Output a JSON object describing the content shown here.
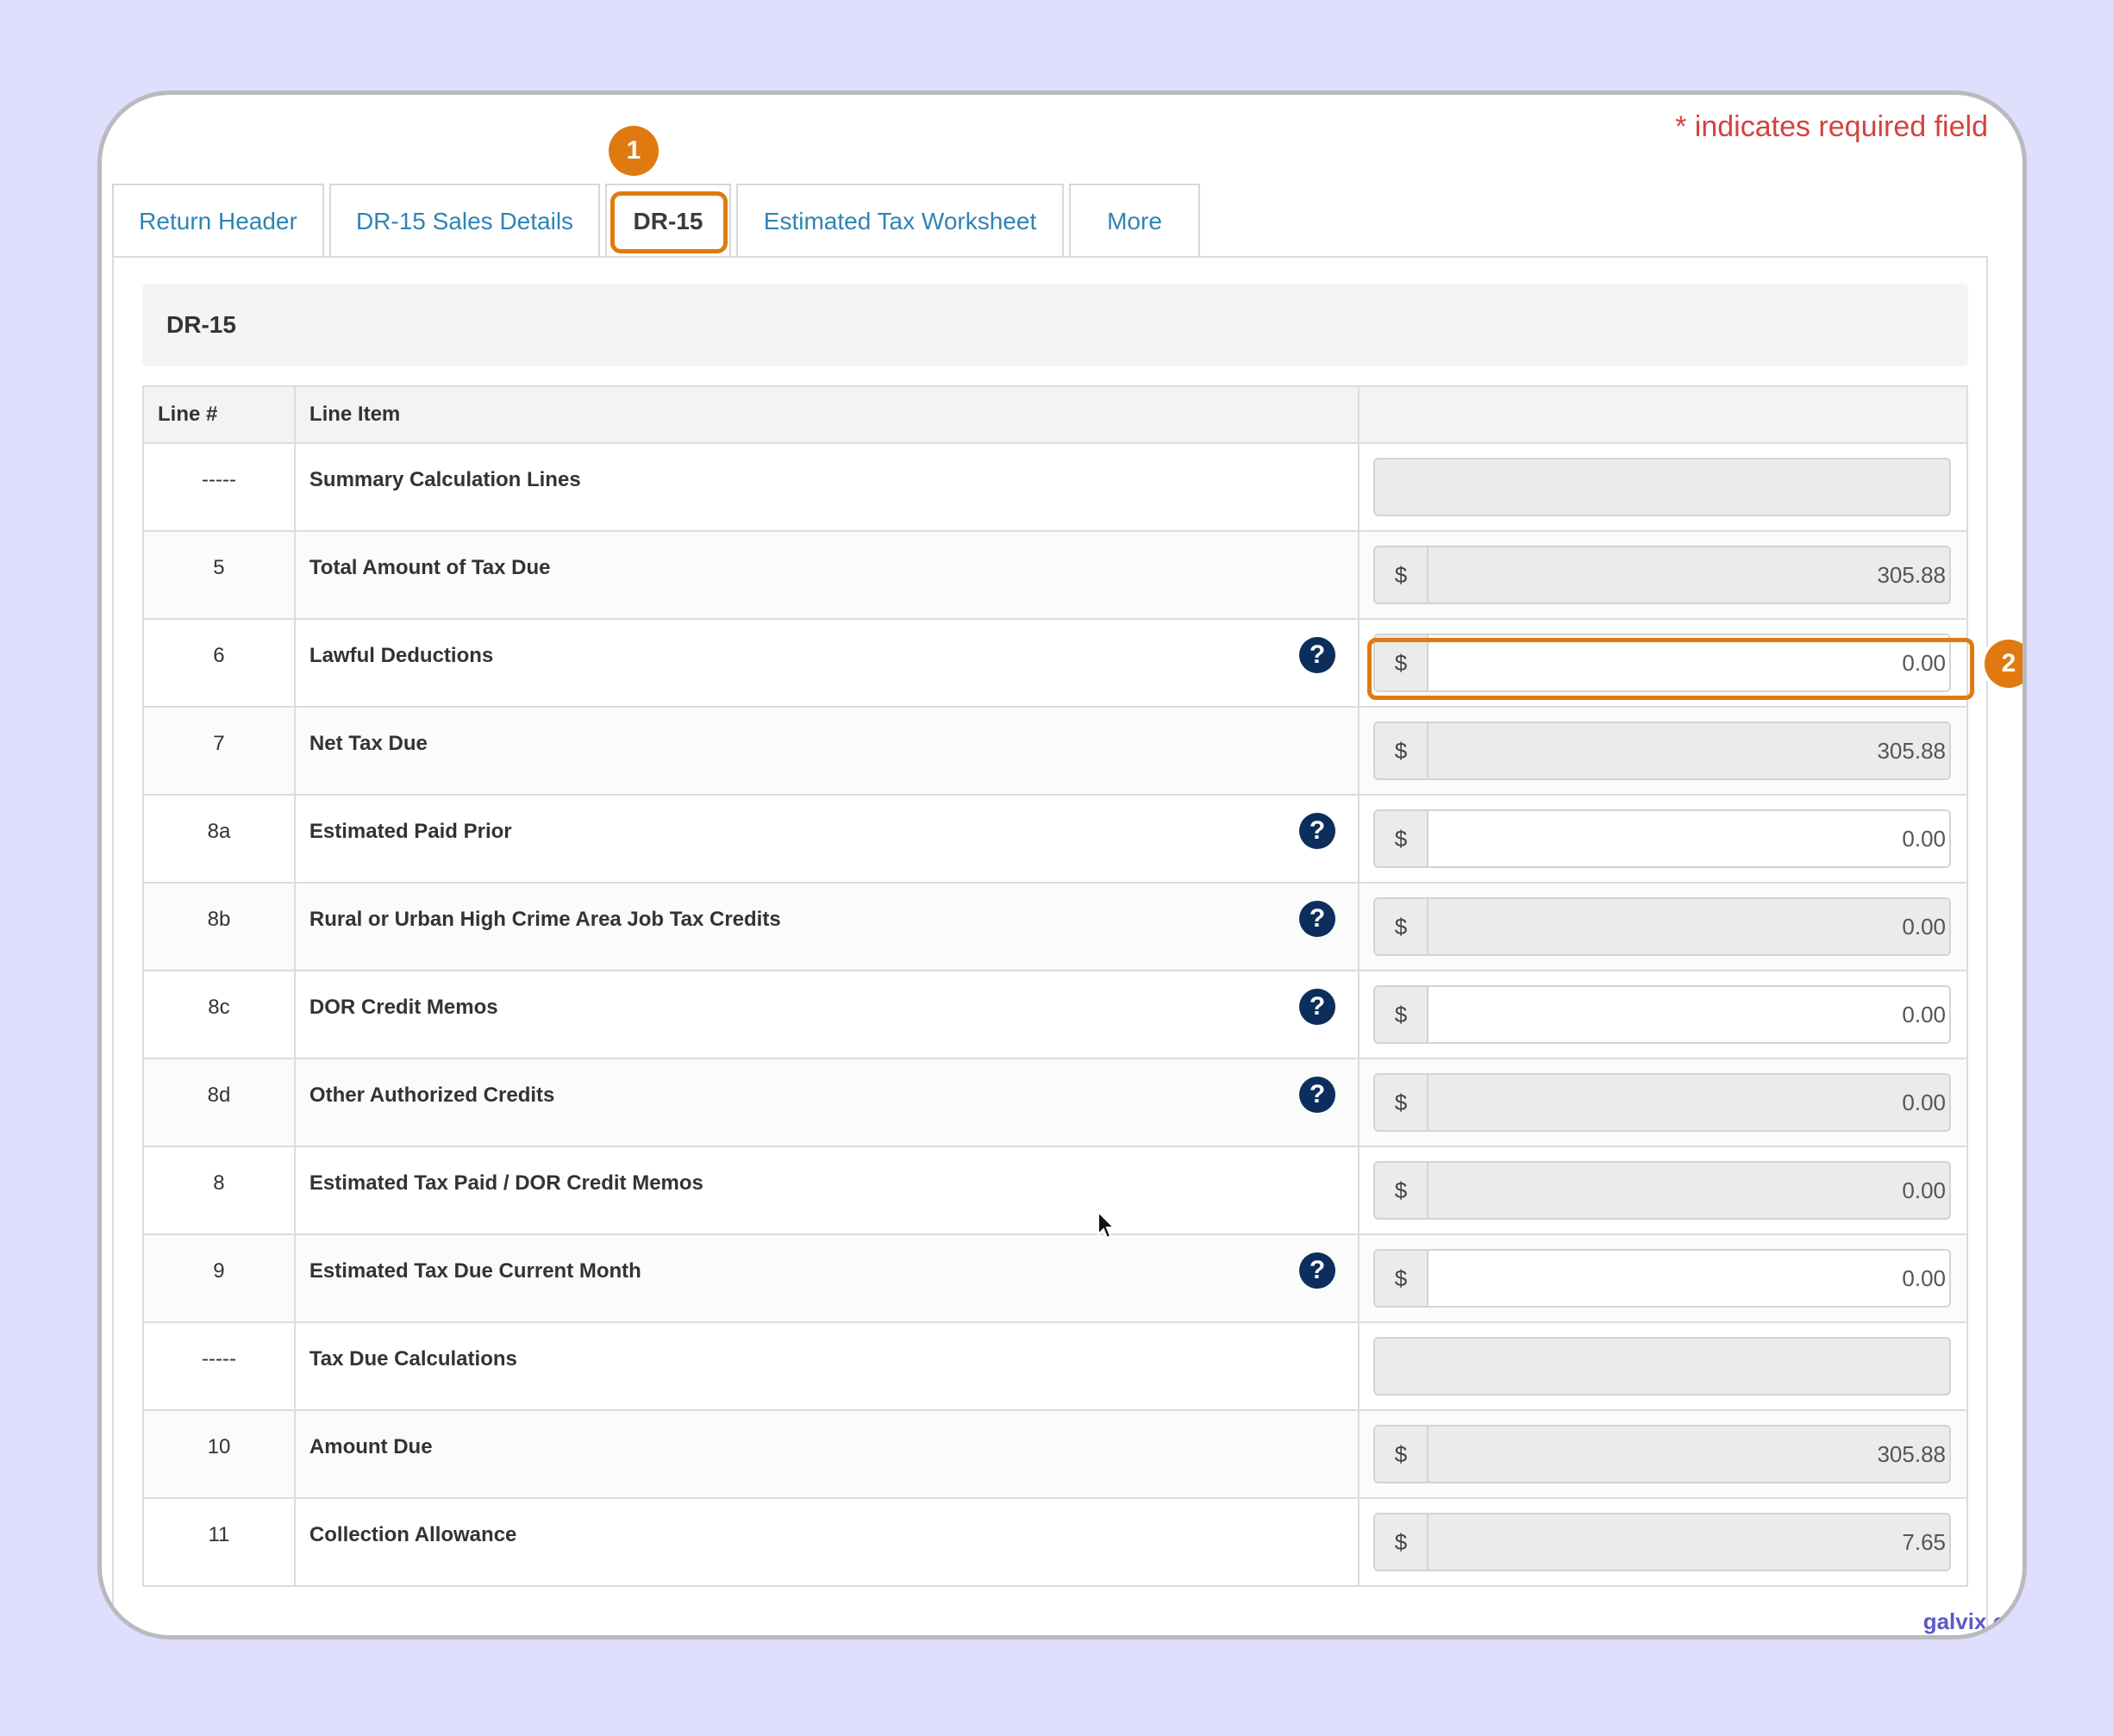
{
  "required_note": "* indicates required field",
  "badges": {
    "step1": "1",
    "step2": "2"
  },
  "tabs": [
    {
      "label": "Return Header",
      "active": false
    },
    {
      "label": "DR-15 Sales Details",
      "active": false
    },
    {
      "label": "DR-15",
      "active": true
    },
    {
      "label": "Estimated Tax Worksheet",
      "active": false
    },
    {
      "label": "More",
      "active": false
    }
  ],
  "section_title": "DR-15",
  "table": {
    "headers": {
      "line": "Line #",
      "item": "Line Item",
      "value": ""
    },
    "currency_symbol": "$",
    "help_glyph": "?",
    "rows": [
      {
        "line": "-----",
        "item": "Summary Calculation Lines",
        "value": null,
        "editable": false,
        "help": false
      },
      {
        "line": "5",
        "item": "Total Amount of Tax Due",
        "value": "305.88",
        "editable": false,
        "help": false
      },
      {
        "line": "6",
        "item": "Lawful Deductions",
        "value": "0.00",
        "editable": true,
        "help": true
      },
      {
        "line": "7",
        "item": "Net Tax Due",
        "value": "305.88",
        "editable": false,
        "help": false
      },
      {
        "line": "8a",
        "item": "Estimated Paid Prior",
        "value": "0.00",
        "editable": true,
        "help": true
      },
      {
        "line": "8b",
        "item": "Rural or Urban High Crime Area Job Tax Credits",
        "value": "0.00",
        "editable": false,
        "help": true
      },
      {
        "line": "8c",
        "item": "DOR Credit Memos",
        "value": "0.00",
        "editable": true,
        "help": true
      },
      {
        "line": "8d",
        "item": "Other Authorized Credits",
        "value": "0.00",
        "editable": false,
        "help": true
      },
      {
        "line": "8",
        "item": "Estimated Tax Paid / DOR Credit Memos",
        "value": "0.00",
        "editable": false,
        "help": false
      },
      {
        "line": "9",
        "item": "Estimated Tax Due Current Month",
        "value": "0.00",
        "editable": true,
        "help": true
      },
      {
        "line": "-----",
        "item": "Tax Due Calculations",
        "value": null,
        "editable": false,
        "help": false
      },
      {
        "line": "10",
        "item": "Amount Due",
        "value": "305.88",
        "editable": false,
        "help": false
      },
      {
        "line": "11",
        "item": "Collection Allowance",
        "value": "7.65",
        "editable": false,
        "help": false
      }
    ]
  },
  "watermark": "galvix.co",
  "colors": {
    "accent": "#e07a10",
    "link": "#2f84b3",
    "required": "#d2433f",
    "help_icon": "#0c2e5c"
  }
}
